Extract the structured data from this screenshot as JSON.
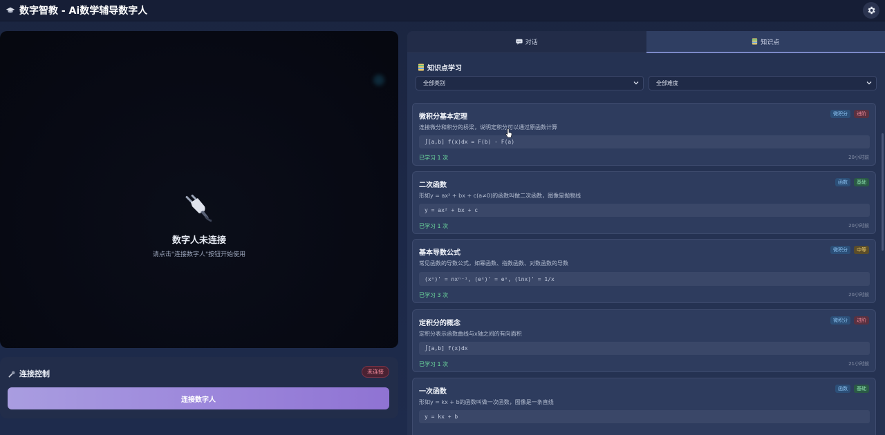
{
  "header": {
    "title": "数字智教 - Ai数学辅导数字人",
    "logo_icon": "graduation-cap-icon",
    "settings_icon": "gear-icon"
  },
  "video": {
    "status_title": "数字人未连接",
    "status_hint": "请点击\"连接数字人\"按钮开始使用",
    "icon": "plug-icon"
  },
  "connection": {
    "title": "连接控制",
    "badge": "未连接",
    "button_label": "连接数字人"
  },
  "tabs": [
    {
      "label": "对话",
      "icon": "chat-icon",
      "active": false
    },
    {
      "label": "知识点",
      "icon": "book-icon",
      "active": true
    }
  ],
  "knowledge": {
    "heading": "知识点学习",
    "filters": {
      "category": "全部类别",
      "difficulty": "全部难度"
    },
    "cards": [
      {
        "title": "微积分基本定理",
        "tags": [
          {
            "text": "微积分",
            "color": "blue"
          },
          {
            "text": "进阶",
            "color": "red"
          }
        ],
        "desc": "连接微分和积分的桥梁，说明定积分可以通过原函数计算",
        "formula": "∫[a,b] f(x)dx = F(b) - F(a)",
        "studied": "已学习 1 次",
        "time": "20小时前"
      },
      {
        "title": "二次函数",
        "tags": [
          {
            "text": "函数",
            "color": "blue"
          },
          {
            "text": "基础",
            "color": "green"
          }
        ],
        "desc": "形如y = ax² + bx + c(a≠0)的函数叫做二次函数，图像是抛物线",
        "formula": "y = ax² + bx + c",
        "studied": "已学习 1 次",
        "time": "20小时前"
      },
      {
        "title": "基本导数公式",
        "tags": [
          {
            "text": "微积分",
            "color": "blue"
          },
          {
            "text": "中等",
            "color": "yellow"
          }
        ],
        "desc": "常见函数的导数公式，如幂函数、指数函数、对数函数的导数",
        "formula": "(xⁿ)' = nxⁿ⁻¹, (eˣ)' = eˣ, (lnx)' = 1/x",
        "studied": "已学习 3 次",
        "time": "20小时前"
      },
      {
        "title": "定积分的概念",
        "tags": [
          {
            "text": "微积分",
            "color": "blue"
          },
          {
            "text": "进阶",
            "color": "red"
          }
        ],
        "desc": "定积分表示函数曲线与x轴之间的有向面积",
        "formula": "∫[a,b] f(x)dx",
        "studied": "已学习 1 次",
        "time": "21小时前"
      },
      {
        "title": "一次函数",
        "tags": [
          {
            "text": "函数",
            "color": "blue"
          },
          {
            "text": "基础",
            "color": "green"
          }
        ],
        "desc": "形如y = kx + b的函数叫做一次函数，图像是一条直线",
        "formula": "y = kx + b",
        "studied": "",
        "time": ""
      }
    ]
  }
}
